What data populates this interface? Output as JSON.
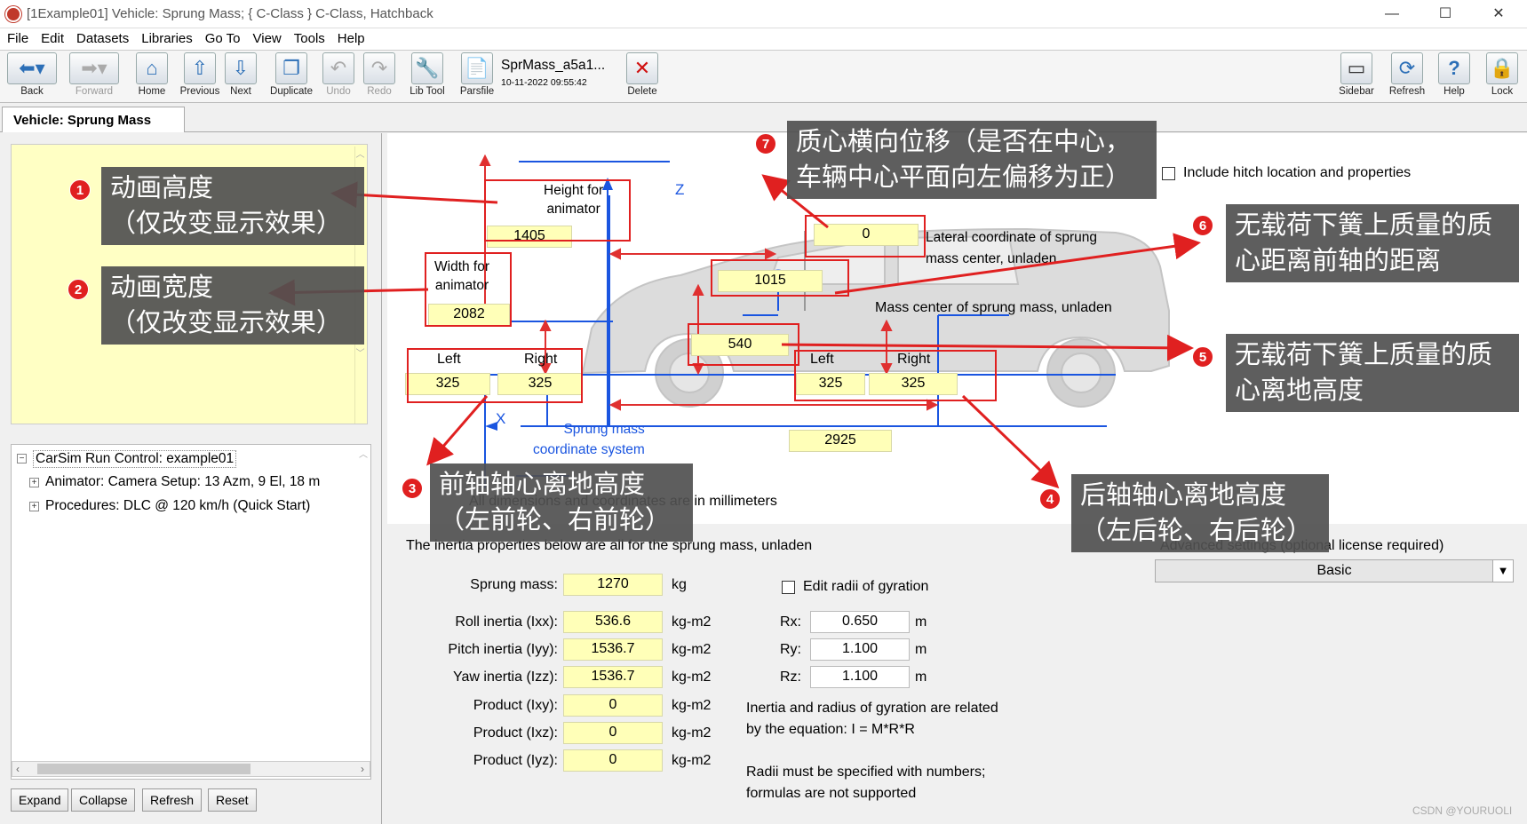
{
  "window": {
    "title": "[1Example01] Vehicle: Sprung Mass; { C-Class } C-Class, Hatchback",
    "minimize": "—",
    "maximize": "☐",
    "close": "✕"
  },
  "menu": [
    "File",
    "Edit",
    "Datasets",
    "Libraries",
    "Go To",
    "View",
    "Tools",
    "Help"
  ],
  "toolbar": {
    "back": "Back",
    "forward": "Forward",
    "home": "Home",
    "previous": "Previous",
    "next": "Next",
    "duplicate": "Duplicate",
    "undo": "Undo",
    "redo": "Redo",
    "libtool": "Lib Tool",
    "parsfile": "Parsfile",
    "dataset_name": "SprMass_a5a1...",
    "dataset_time": "10-11-2022 09:55:42",
    "delete": "Delete",
    "sidebar": "Sidebar",
    "refresh": "Refresh",
    "help": "Help",
    "lock": "Lock"
  },
  "tab": {
    "label": "Vehicle: Sprung Mass"
  },
  "tree": {
    "root": "CarSim Run Control: example01",
    "items": [
      "Animator: Camera Setup: 13 Azm, 9 El, 18 m",
      "Procedures: DLC @ 120 km/h (Quick Start)"
    ],
    "buttons": [
      "Expand",
      "Collapse",
      "Refresh",
      "Reset"
    ]
  },
  "diagram": {
    "height_label": "Height for\nanimator",
    "height_value": "1405",
    "width_label": "Width for\nanimator",
    "width_value": "2082",
    "lateral_value": "0",
    "lateral_label": "Lateral coordinate of sprung\nmass center, unladen",
    "cg_x_value": "1015",
    "cg_label": "Mass center of sprung mass, unladen",
    "cg_height_value": "540",
    "front_left_label": "Left",
    "front_right_label": "Right",
    "front_left": "325",
    "front_right": "325",
    "rear_left_label": "Left",
    "rear_right_label": "Right",
    "rear_left": "325",
    "rear_right": "325",
    "wheelbase": "2925",
    "axis_z": "Z",
    "axis_x": "X",
    "coord_label": "Sprung mass\ncoordinate system",
    "hitch_label": "Include hitch location and properties",
    "units_note": "All dimensions and coordinates are in millimeters"
  },
  "inertia": {
    "note": "The inertia properties below are all for the sprung mass, unladen",
    "advanced_label": "Advanced settings (optional license required)",
    "advanced_value": "Basic",
    "sprung_mass_label": "Sprung mass:",
    "sprung_mass": "1270",
    "sprung_mass_unit": "kg",
    "rows": [
      {
        "label": "Roll inertia (Ixx):",
        "value": "536.6",
        "unit": "kg-m2"
      },
      {
        "label": "Pitch inertia (Iyy):",
        "value": "1536.7",
        "unit": "kg-m2"
      },
      {
        "label": "Yaw inertia (Izz):",
        "value": "1536.7",
        "unit": "kg-m2"
      },
      {
        "label": "Product (Ixy):",
        "value": "0",
        "unit": "kg-m2"
      },
      {
        "label": "Product (Ixz):",
        "value": "0",
        "unit": "kg-m2"
      },
      {
        "label": "Product (Iyz):",
        "value": "0",
        "unit": "kg-m2"
      }
    ],
    "gyration_check": "Edit radii of gyration",
    "radii": [
      {
        "label": "Rx:",
        "value": "0.650",
        "unit": "m"
      },
      {
        "label": "Ry:",
        "value": "1.100",
        "unit": "m"
      },
      {
        "label": "Rz:",
        "value": "1.100",
        "unit": "m"
      }
    ],
    "note2": "Inertia and radius of gyration are related\nby the equation: I = M*R*R",
    "note3": "Radii must be specified with numbers;\nformulas are not supported"
  },
  "callouts": [
    {
      "num": "1",
      "text": "动画高度\n（仅改变显示效果）"
    },
    {
      "num": "2",
      "text": "动画宽度\n（仅改变显示效果）"
    },
    {
      "num": "3",
      "text": "前轴轴心离地高度\n（左前轮、右前轮）"
    },
    {
      "num": "4",
      "text": "后轴轴心离地高度\n（左后轮、右后轮）"
    },
    {
      "num": "5",
      "text": "无载荷下簧上质量的质\n心离地高度"
    },
    {
      "num": "6",
      "text": "无载荷下簧上质量的质\n心距离前轴的距离"
    },
    {
      "num": "7",
      "text": "质心横向位移（是否在中心，\n车辆中心平面向左偏移为正）"
    }
  ],
  "watermark": "CSDN @YOURUOLI"
}
